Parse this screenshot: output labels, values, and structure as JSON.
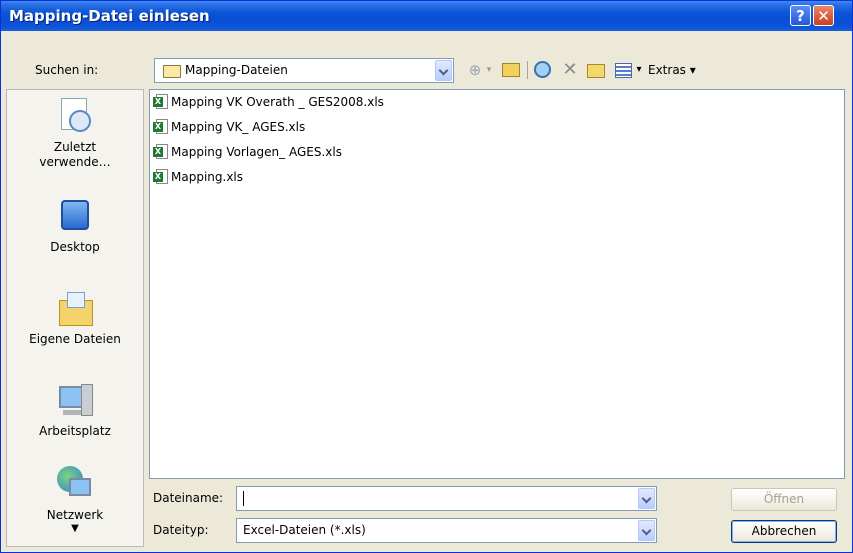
{
  "window": {
    "title": "Mapping-Datei einlesen",
    "help_symbol": "?",
    "close_symbol": "✕"
  },
  "lookin": {
    "label": "Suchen in:",
    "folder": "Mapping-Dateien"
  },
  "toolbar": {
    "views_arrow": "▾",
    "extras_label": "Extras ▾"
  },
  "places": [
    {
      "label": "Zuletzt verwende…",
      "icon": "recent-documents-icon"
    },
    {
      "label": "Desktop",
      "icon": "desktop-icon"
    },
    {
      "label": "Eigene Dateien",
      "icon": "my-documents-icon"
    },
    {
      "label": "Arbeitsplatz",
      "icon": "my-computer-icon"
    },
    {
      "label": "Netzwerk",
      "icon": "network-icon"
    }
  ],
  "places_scroll_arrow": "▼",
  "files": [
    {
      "name": "Mapping VK Overath _ GES2008.xls"
    },
    {
      "name": "Mapping VK_ AGES.xls"
    },
    {
      "name": "Mapping Vorlagen_ AGES.xls"
    },
    {
      "name": "Mapping.xls"
    }
  ],
  "filename": {
    "label": "Dateiname:",
    "value": ""
  },
  "filetype": {
    "label": "Dateityp:",
    "value": "Excel-Dateien (*.xls)"
  },
  "buttons": {
    "open": "Öffnen",
    "cancel": "Abbrechen"
  }
}
